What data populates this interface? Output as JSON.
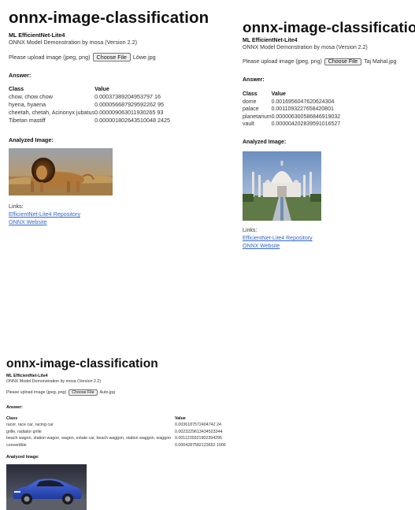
{
  "panels": [
    {
      "title": "onnx-image-classification",
      "model_name": "ML EfficientNet-Lite4",
      "demo_text": "ONNX Model Demonstration by mosa (Version 2.2)",
      "upload_prompt": "Please upload image (jpeg, png)",
      "choose_file_label": "Choose File",
      "file_name": "Löwe.jpg",
      "answer_label": "Answer:",
      "table_headers": [
        "Class",
        "Value"
      ],
      "rows": [
        [
          "chow, chow chow",
          "0.00037389204953797 16"
        ],
        [
          "hyena, hyaena",
          "0.000056687929592262 95"
        ],
        [
          "cheetah, chetah, Acinonyx jubatus",
          "0.000009063011930265 93"
        ],
        [
          "Tibetan mastiff",
          "0.000001802643510048 2425"
        ]
      ],
      "analyzed_label": "Analyzed Image:",
      "image_name": "lion-photo",
      "links_label": "Links:",
      "links": [
        "EfficientNet-Lite4 Repository",
        "ONNX Website"
      ]
    },
    {
      "title": "onnx-image-classification",
      "model_name": "ML EfficientNet-Lite4",
      "demo_text": "ONNX Model Demonstration by mosa (Version 2.2)",
      "upload_prompt": "Please upload image (jpeg, png)",
      "choose_file_label": "Choose File",
      "file_name": "Taj Mahal.jpg",
      "answer_label": "Answer:",
      "table_headers": [
        "Class",
        "Value"
      ],
      "rows": [
        [
          "dome",
          "0.0016956047620624304"
        ],
        [
          "palace",
          "0.0011093227658420801"
        ],
        [
          "planetarium",
          "0.000006300586846919032"
        ],
        [
          "vault",
          "0.000004202839591016527"
        ]
      ],
      "analyzed_label": "Analyzed Image:",
      "image_name": "taj-mahal-photo",
      "links_label": "Links:",
      "links": [
        "EfficientNet-Lite4 Repository",
        "ONNX Website"
      ]
    },
    {
      "title": "onnx-image-classification",
      "model_name": "ML EfficientNet-Lite4",
      "demo_text": "ONNX Model Demonstration by mosa (Version 2.2)",
      "upload_prompt": "Please upload image (jpeg, png)",
      "choose_file_label": "Choose File",
      "file_name": "Auto.jpg",
      "answer_label": "Answer:",
      "table_headers": [
        "Class",
        "Value"
      ],
      "rows": [
        [
          "racer, race car, racing car",
          "0.0036187572404742 24"
        ],
        [
          "grille, radiator grille",
          "0.0023229613434523344"
        ],
        [
          "beach wagon, station wagon, wagon, estate car, beach waggon, station waggon, waggon",
          "0.0011239321902394295"
        ],
        [
          "convertible",
          "0.0004287582123652 1006"
        ]
      ],
      "analyzed_label": "Analyzed Image:",
      "image_name": "sports-car-photo"
    }
  ],
  "colors": {
    "link": "#3366cc",
    "text": "#222222",
    "button_bg": "#efefef"
  }
}
